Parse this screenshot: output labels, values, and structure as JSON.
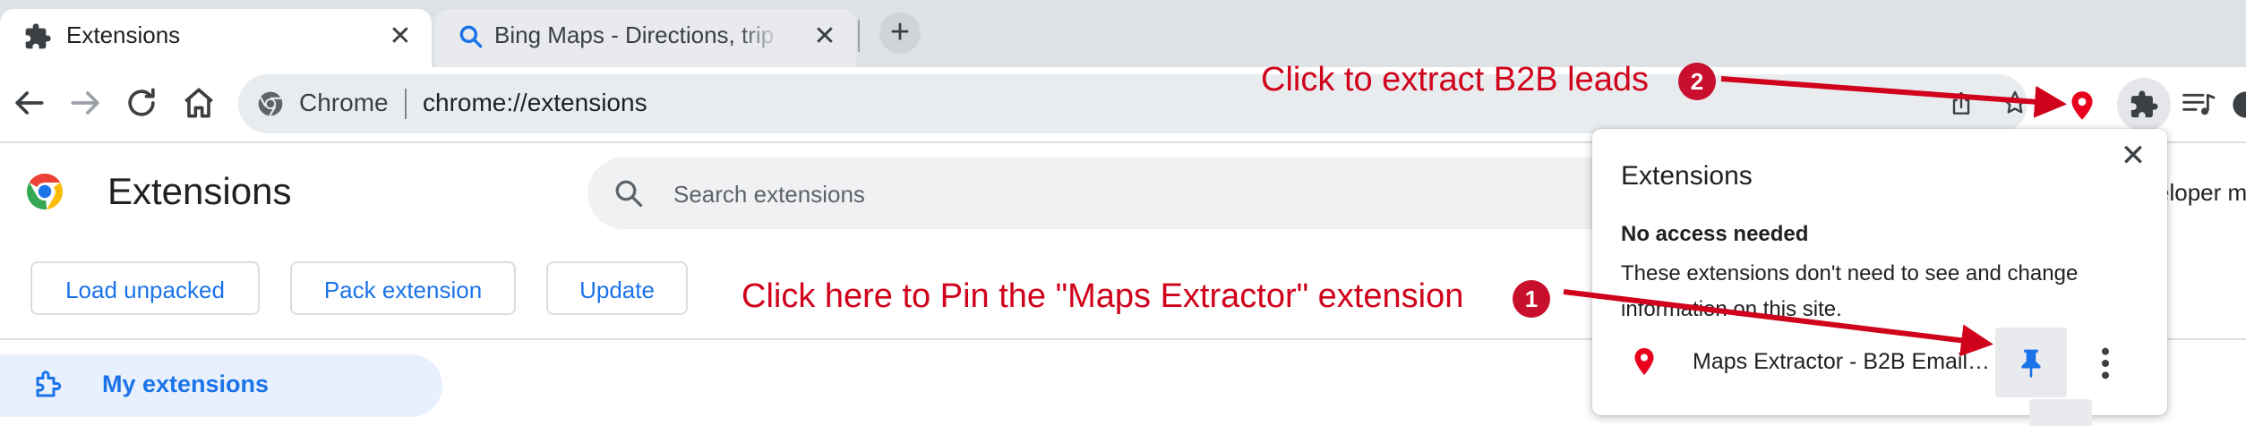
{
  "tabs": [
    {
      "title": "Extensions",
      "icon": "puzzle-icon",
      "active": true
    },
    {
      "title": "Bing Maps - Directions, trip planner, traffic cameras",
      "icon": "search-icon",
      "active": false
    }
  ],
  "toolbar": {
    "omnibox_chip": "Chrome",
    "url": "chrome://extensions"
  },
  "page": {
    "title": "Extensions",
    "search_placeholder": "Search extensions",
    "developer_mode_label": "eloper m",
    "buttons": {
      "load_unpacked": "Load unpacked",
      "pack_extension": "Pack extension",
      "update": "Update"
    },
    "sidebar": {
      "my_extensions": "My extensions"
    }
  },
  "popup": {
    "title": "Extensions",
    "section": "No access needed",
    "description": "These extensions don't need to see and change information on this site.",
    "row_name": "Maps Extractor - B2B Email…"
  },
  "annotations": [
    {
      "badge": "1",
      "text": "Click here to Pin the \"Maps Extractor\" extension"
    },
    {
      "badge": "2",
      "text": "Click to extract B2B leads"
    }
  ],
  "colors": {
    "annotation": "#d0021b",
    "accent": "#1a73e8",
    "pin_marker": "#e8001c"
  }
}
